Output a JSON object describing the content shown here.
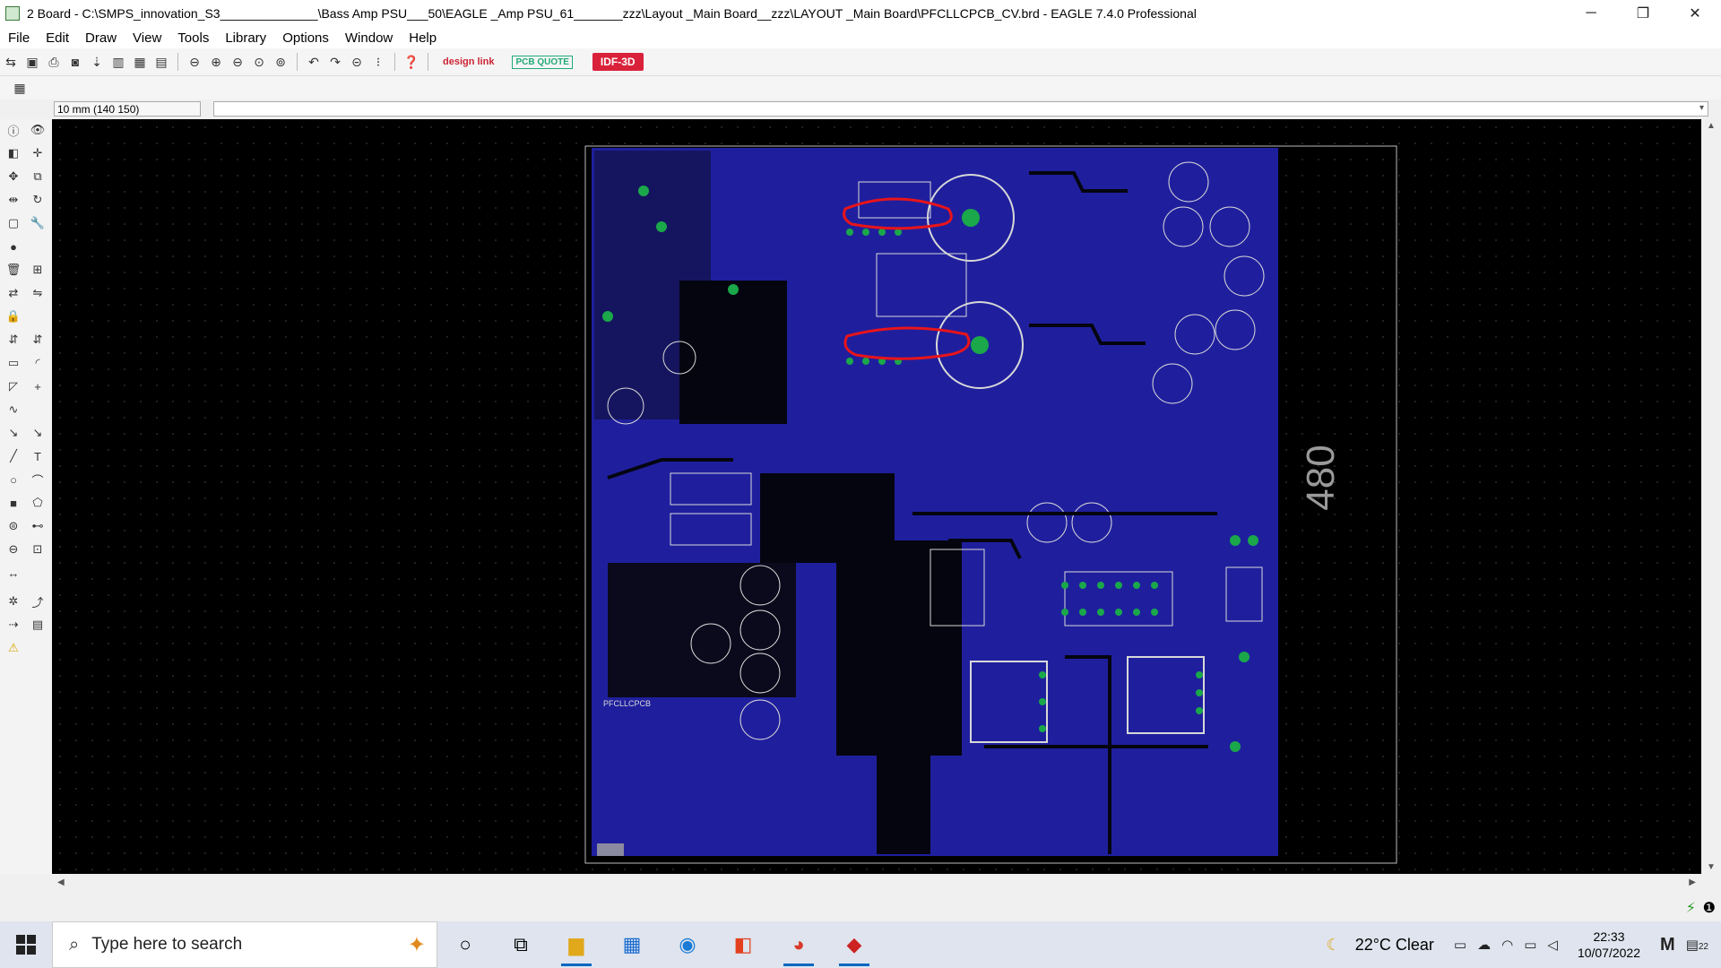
{
  "window": {
    "title": "2 Board - C:\\SMPS_innovation_S3______________\\Bass Amp PSU___50\\EAGLE _Amp PSU_61_______zzz\\Layout _Main Board__zzz\\LAYOUT _Main Board\\PFCLLCPCB_CV.brd - EAGLE 7.4.0 Professional",
    "minimize": "─",
    "maximize": "❐",
    "close": "✕"
  },
  "menu": [
    "File",
    "Edit",
    "Draw",
    "View",
    "Tools",
    "Library",
    "Options",
    "Window",
    "Help"
  ],
  "toolbar": {
    "idf_label": "IDF-3D",
    "design_link": "design\nlink",
    "pcb_quote": "PCB QUOTE"
  },
  "coord": {
    "value": "10 mm (140 150)"
  },
  "board": {
    "dimension_label": "480",
    "board_name_label": "PFCLLCPCB",
    "colors": {
      "board": "#1f1f9e",
      "pad": "#1aa84a",
      "silk": "#d8d8d8",
      "annotation": "#e8141a"
    }
  },
  "taskbar": {
    "search_placeholder": "Type here to search",
    "weather": "22°C  Clear",
    "time": "22:33",
    "date": "10/07/2022",
    "notif_count": "22"
  }
}
